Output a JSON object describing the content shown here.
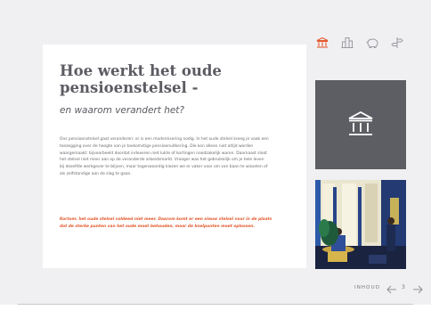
{
  "article": {
    "title": "Hoe werkt het oude pensioenstelsel -",
    "subtitle": "en waarom verandert het?",
    "body": "Ons pensioenstelsel gaat veranderen: er is een modernisering nodig. In het oude stelsel kreeg je vaak een toezegging over de hoogte van je toekomstige pensioenuitkering. Die kon alleen niet altijd worden waargemaakt: bijvoorbeeld doordat indexeren niet lukte of kortingen noodzakelijk waren. Daarnaast sloot het stelsel niet meer aan op de veranderde arbeidsmarkt. Vroeger was het gebruikelijk om je hele leven bij dezelfde werkgever te blijven, maar tegenwoordig kiezen we er vaker voor om van baan te wisselen of als zelfstandige aan de slag te gaan.",
    "quote": "Kortom: het oude stelsel voldeed niet meer. Daarom komt er een nieuw stelsel voor in de plaats dat de sterke punten van het oude moet behouden, maar de knelpunten moet oplossen."
  },
  "nav_icons": [
    {
      "name": "institution-icon",
      "active": true
    },
    {
      "name": "buildings-icon",
      "active": false
    },
    {
      "name": "piggy-bank-icon",
      "active": false
    },
    {
      "name": "signpost-icon",
      "active": false
    }
  ],
  "footer": {
    "label": "INHOUD",
    "page": "3"
  },
  "colors": {
    "accent": "#e4592e",
    "tile": "#5d5e63",
    "text": "#5b5b62",
    "background": "#f0f0f2"
  }
}
